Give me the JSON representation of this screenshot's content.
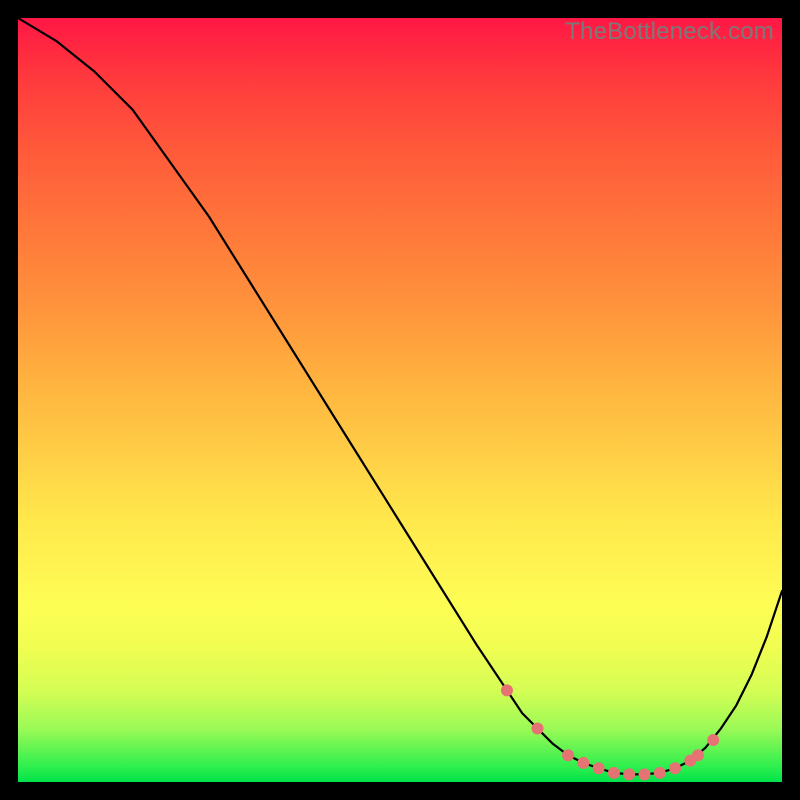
{
  "watermark": "TheBottleneck.com",
  "chart_data": {
    "type": "line",
    "title": "",
    "xlabel": "",
    "ylabel": "",
    "xlim": [
      0,
      100
    ],
    "ylim": [
      0,
      100
    ],
    "grid": false,
    "series": [
      {
        "name": "curve",
        "color": "#000000",
        "x": [
          0,
          5,
          10,
          15,
          20,
          25,
          30,
          35,
          40,
          45,
          50,
          55,
          60,
          62,
          64,
          66,
          68,
          70,
          72,
          74,
          76,
          78,
          80,
          82,
          84,
          86,
          88,
          90,
          92,
          94,
          96,
          98,
          100
        ],
        "y": [
          100,
          97,
          93,
          88,
          81,
          74,
          66,
          58,
          50,
          42,
          34,
          26,
          18,
          15,
          12,
          9,
          7,
          5,
          3.5,
          2.5,
          1.8,
          1.2,
          1.0,
          1.0,
          1.2,
          1.8,
          2.8,
          4.5,
          7,
          10,
          14,
          19,
          25
        ]
      }
    ],
    "markers": {
      "name": "highlight-dots",
      "color": "#e57373",
      "radius": 6,
      "points": [
        {
          "x": 64,
          "y": 12
        },
        {
          "x": 68,
          "y": 7
        },
        {
          "x": 72,
          "y": 3.5
        },
        {
          "x": 74,
          "y": 2.5
        },
        {
          "x": 76,
          "y": 1.8
        },
        {
          "x": 78,
          "y": 1.2
        },
        {
          "x": 80,
          "y": 1.0
        },
        {
          "x": 82,
          "y": 1.0
        },
        {
          "x": 84,
          "y": 1.2
        },
        {
          "x": 86,
          "y": 1.8
        },
        {
          "x": 88,
          "y": 2.8
        },
        {
          "x": 89,
          "y": 3.5
        },
        {
          "x": 91,
          "y": 5.5
        }
      ]
    }
  }
}
